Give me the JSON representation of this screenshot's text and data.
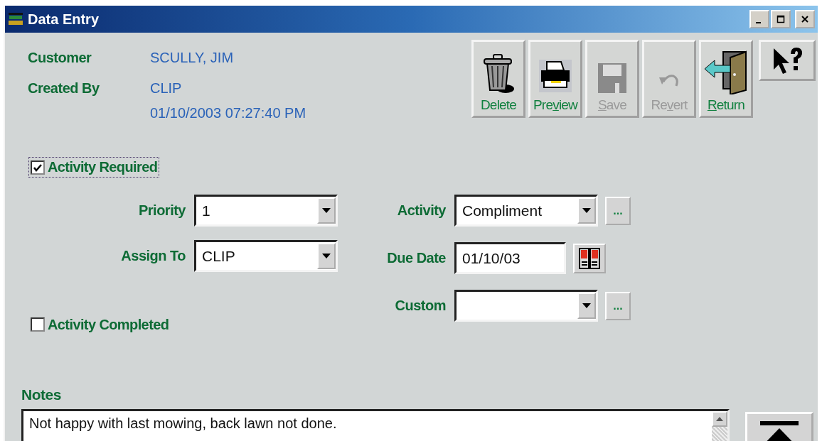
{
  "window": {
    "title": "Data Entry"
  },
  "info": [
    {
      "label": "Customer",
      "values": [
        "SCULLY, JIM"
      ]
    },
    {
      "label": "Created By",
      "values": [
        "CLIP",
        "01/10/2003 07:27:40 PM"
      ]
    }
  ],
  "toolbar": [
    {
      "kind": "trash",
      "label": "Delete",
      "disabled": false
    },
    {
      "kind": "printer",
      "label": "Pre",
      "access_key": "v",
      "label_rest": "iew",
      "disabled": false
    },
    {
      "kind": "disk",
      "access_key": "S",
      "label_rest": "ave",
      "disabled": true
    },
    {
      "kind": "undo",
      "label": "Re",
      "access_key": "v",
      "label_rest": "ert",
      "disabled": true
    },
    {
      "kind": "door",
      "access_key": "R",
      "label_rest": "eturn",
      "disabled": false
    },
    {
      "kind": "help"
    }
  ],
  "activity_required": {
    "label": "Activity Required",
    "checked": true,
    "focused": true
  },
  "left_fields": [
    {
      "label": "Priority",
      "value": "1"
    },
    {
      "label": "Assign To",
      "value": "CLIP"
    }
  ],
  "right_fields": [
    {
      "kind": "combo",
      "label": "Activity",
      "value": "Compliment",
      "ellipsis": "..."
    },
    {
      "kind": "date",
      "label": "Due Date",
      "value": "01/10/03"
    },
    {
      "kind": "combo",
      "label": "Custom",
      "ellipsis": "..."
    }
  ],
  "activity_completed": {
    "label": "Activity Completed",
    "checked": false,
    "focused": false
  },
  "notes": {
    "label": "Notes",
    "value": "Not happy with last mowing, back lawn not done."
  }
}
